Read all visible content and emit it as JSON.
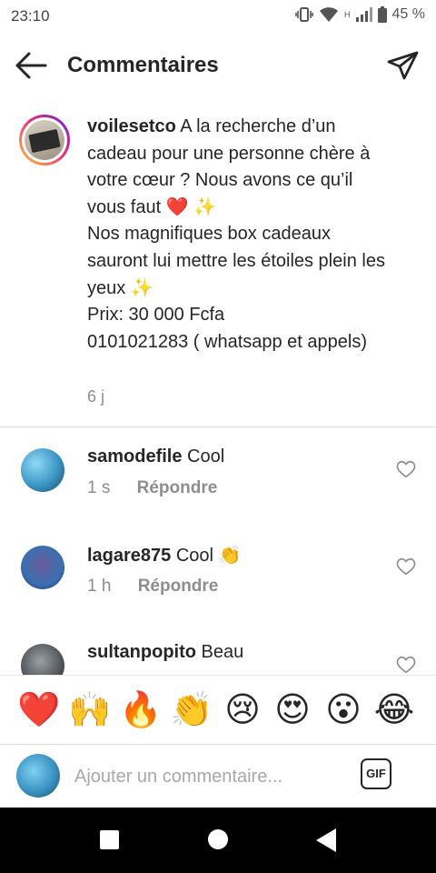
{
  "status_bar": {
    "time": "23:10",
    "network_type": "H",
    "battery": "45 %",
    "icons": [
      "vibrate-icon",
      "wifi-icon",
      "signal-icon",
      "battery-icon"
    ]
  },
  "header": {
    "title": "Commentaires",
    "back_icon": "arrow-left-icon",
    "direct_icon": "paper-plane-icon"
  },
  "caption": {
    "username": "voilesetco",
    "lines": [
      "A la recherche d’un cadeau pour une personne chère à votre cœur ? Nous avons ce qu’il vous faut ❤️ ✨",
      "Nos magnifiques box cadeaux sauront lui mettre les étoiles plein les yeux ✨",
      "Prix: 30 000 Fcfa",
      "0101021283 ( whatsapp et appels)"
    ],
    "time": "6 j"
  },
  "comments": [
    {
      "username": "samodefile",
      "text": "Cool",
      "time": "1 s",
      "reply_label": "Répondre"
    },
    {
      "username": "lagare875",
      "text": "Cool 👏",
      "time": "1 h",
      "reply_label": "Répondre"
    },
    {
      "username": "sultanpopito",
      "text": "Beau",
      "time": "",
      "reply_label": ""
    }
  ],
  "emoji_bar": [
    "❤️",
    "🙌",
    "🔥",
    "👏",
    "😢",
    "😍",
    "😮",
    "😂"
  ],
  "input": {
    "placeholder": "Ajouter un commentaire...",
    "gif_label": "GIF"
  },
  "colors": {
    "text": "#262626",
    "secondary": "#8e8e8e",
    "story_ring_start": "#f9ce34",
    "story_ring_mid": "#ee2a7b",
    "story_ring_end": "#6228d7",
    "nav_bar": "#000000"
  }
}
